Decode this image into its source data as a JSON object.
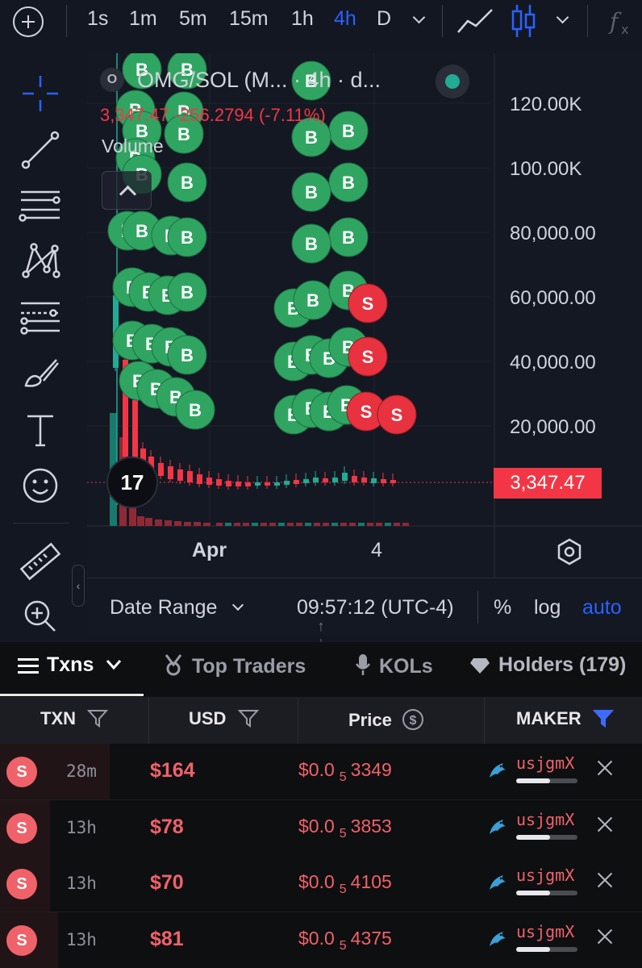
{
  "toolbar": {
    "intervals": [
      "1s",
      "1m",
      "5m",
      "15m",
      "1h",
      "4h",
      "D"
    ],
    "active_interval": "4h"
  },
  "chart": {
    "legend_symbol_badge": "O",
    "legend_title": "OMG/SOL (M... · 4h · d...",
    "legend_ohlc": "3,347.47  -256.2794 (-7.11%)",
    "legend_volume": "Volume",
    "price_axis": [
      "120.00K",
      "100.00K",
      "80,000.00",
      "60,000.00",
      "40,000.00",
      "20,000.00"
    ],
    "last_price": "3,347.47",
    "time_axis": [
      "Apr",
      "4"
    ],
    "tv_logo": "17",
    "marker_buy": "B",
    "marker_sell": "S",
    "colors": {
      "up": "#22ab94",
      "down": "#f23645",
      "buy_marker": "#2fa561",
      "sell_marker": "#e8323f",
      "accent": "#2962ff"
    }
  },
  "date_bar": {
    "range_label": "Date Range",
    "time": "09:57:12 (UTC-4)",
    "percent": "%",
    "log": "log",
    "auto": "auto"
  },
  "tabs": [
    {
      "label": "Txns",
      "icon": "list-icon",
      "active": true
    },
    {
      "label": "Top Traders",
      "icon": "medal-icon",
      "active": false
    },
    {
      "label": "KOLs",
      "icon": "microphone-icon",
      "active": false
    },
    {
      "label": "Holders (179)",
      "icon": "diamond-icon",
      "active": false
    }
  ],
  "table": {
    "headers": {
      "txn": "TXN",
      "usd": "USD",
      "price": "Price",
      "maker": "MAKER"
    },
    "rows": [
      {
        "type": "S",
        "age": "28m",
        "usd": "$164",
        "price_prefix": "$0.0",
        "price_zeros": "5",
        "price_digits": "3349",
        "maker": "usjgmX",
        "maker_fill": 0.55
      },
      {
        "type": "S",
        "age": "13h",
        "usd": "$78",
        "price_prefix": "$0.0",
        "price_zeros": "5",
        "price_digits": "3853",
        "maker": "usjgmX",
        "maker_fill": 0.55
      },
      {
        "type": "S",
        "age": "13h",
        "usd": "$70",
        "price_prefix": "$0.0",
        "price_zeros": "5",
        "price_digits": "4105",
        "maker": "usjgmX",
        "maker_fill": 0.55
      },
      {
        "type": "S",
        "age": "13h",
        "usd": "$81",
        "price_prefix": "$0.0",
        "price_zeros": "5",
        "price_digits": "4375",
        "maker": "usjgmX",
        "maker_fill": 0.55
      }
    ]
  }
}
